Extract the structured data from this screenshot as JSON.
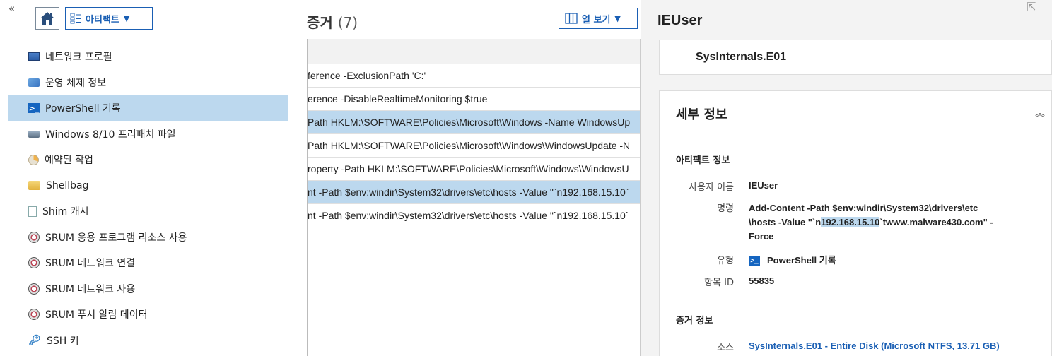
{
  "toolbar": {
    "artifact_label": "아티팩트"
  },
  "artifacts": [
    {
      "label": "네트워크 프로필",
      "icon": "network-profile-icon"
    },
    {
      "label": "운영 체제 정보",
      "icon": "os-info-icon"
    },
    {
      "label": "PowerShell 기록",
      "icon": "powershell-icon",
      "selected": true
    },
    {
      "label": "Windows 8/10 프리패치 파일",
      "icon": "prefetch-icon"
    },
    {
      "label": "예약된 작업",
      "icon": "scheduled-task-icon"
    },
    {
      "label": "Shellbag",
      "icon": "folder-icon"
    },
    {
      "label": "Shim 캐시",
      "icon": "page-icon"
    },
    {
      "label": "SRUM 응용 프로그램 리소스 사용",
      "icon": "srum-icon"
    },
    {
      "label": "SRUM 네트워크 연결",
      "icon": "srum-icon"
    },
    {
      "label": "SRUM 네트워크 사용",
      "icon": "srum-icon"
    },
    {
      "label": "SRUM 푸시 알림 데이터",
      "icon": "srum-icon"
    },
    {
      "label": "SSH 키",
      "icon": "key-icon"
    }
  ],
  "evidence": {
    "title": "증거",
    "count": "(7)",
    "columns_label": "열 보기",
    "rows": [
      {
        "text": "ference -ExclusionPath 'C:'"
      },
      {
        "text": "erence -DisableRealtimeMonitoring $true"
      },
      {
        "text": "Path HKLM:\\SOFTWARE\\Policies\\Microsoft\\Windows -Name WindowsUp",
        "selected": true
      },
      {
        "text": "Path HKLM:\\SOFTWARE\\Policies\\Microsoft\\Windows\\WindowsUpdate -N"
      },
      {
        "text": "roperty -Path HKLM:\\SOFTWARE\\Policies\\Microsoft\\Windows\\WindowsU"
      },
      {
        "text": "nt -Path $env:windir\\System32\\drivers\\etc\\hosts -Value \"`n192.168.15.10`",
        "selected": true
      },
      {
        "text": "nt -Path $env:windir\\System32\\drivers\\etc\\hosts -Value \"`n192.168.15.10`"
      }
    ]
  },
  "details": {
    "user_title": "IEUser",
    "source_name": "SysInternals.E01",
    "section_title": "세부 정보",
    "artifact_info_title": "아티팩트 정보",
    "username_label": "사용자 이름",
    "username_value": "IEUser",
    "command_label": "명령",
    "command_line1": "Add-Content -Path $env:windir\\System32\\drivers\\etc",
    "command_line2_pre": "\\hosts -Value \"`n",
    "command_line2_hl": "192.168.15.10",
    "command_line2_post": "`twww.malware430.com\" -",
    "command_line3": "Force",
    "type_label": "유형",
    "type_value": "PowerShell 기록",
    "item_id_label": "항목 ID",
    "item_id_value": "55835",
    "evidence_info_title": "증거 정보",
    "source_label": "소스",
    "source_value": "SysInternals.E01 - Entire Disk (Microsoft NTFS, 13.71 GB)"
  }
}
